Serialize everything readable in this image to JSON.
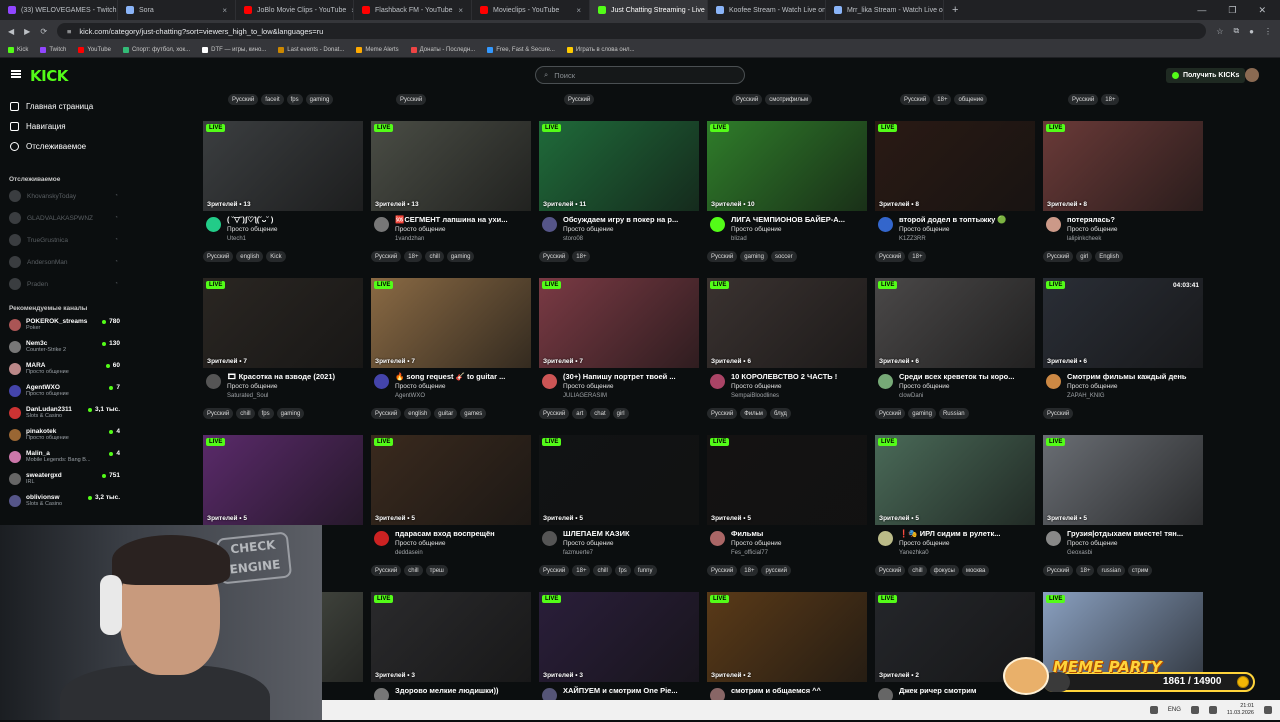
{
  "browser": {
    "tabs": [
      {
        "label": "(33) WELOVEGAMES - Twitch",
        "color": "#9146ff"
      },
      {
        "label": "Sora",
        "color": "#8ab4f8"
      },
      {
        "label": "JoBlo Movie Clips - YouTube",
        "color": "#ff0000"
      },
      {
        "label": "Flashback FM - YouTube",
        "color": "#ff0000"
      },
      {
        "label": "Movieclips - YouTube",
        "color": "#ff0000"
      },
      {
        "label": "Just Chatting Streaming - Live",
        "color": "#53fc18"
      },
      {
        "label": "Koofee Stream - Watch Live on",
        "color": "#8ab4f8"
      },
      {
        "label": "Mrr_lika Stream - Watch Live o",
        "color": "#8ab4f8"
      }
    ],
    "url": "kick.com/category/just-chatting?sort=viewers_high_to_low&languages=ru",
    "bookmarks": [
      "Kick",
      "Twitch",
      "YouTube",
      "Спорт: футбол, хок...",
      "DTF — игры, кино...",
      "Last events - Donat...",
      "Meme Alerts",
      "Донаты - Последн...",
      "Free, Fast & Secure...",
      "Играть в слова онл..."
    ]
  },
  "header": {
    "logo": "KICK",
    "search_placeholder": "Поиск",
    "get_kicks": "Получить KICKs"
  },
  "sidebar": {
    "nav": [
      "Главная страница",
      "Навигация",
      "Отслеживаемое"
    ],
    "followed_title": "Отслеживаемое",
    "followed": [
      "KhovanskyToday",
      "GLADVALAKASPWNZ",
      "TrueGrustnica",
      "AndersonMan",
      "Praden"
    ],
    "recommended_title": "Рекомендуемые каналы",
    "recommended": [
      {
        "name": "POKEROK_streams",
        "category": "Poker",
        "viewers": "780",
        "color": "#a55"
      },
      {
        "name": "Nem3c",
        "category": "Counter-Strike 2",
        "viewers": "130",
        "color": "#777"
      },
      {
        "name": "MARA",
        "category": "Просто общение",
        "viewers": "60",
        "color": "#b88"
      },
      {
        "name": "AgentWXO",
        "category": "Просто общение",
        "viewers": "7",
        "color": "#44a"
      },
      {
        "name": "DanLudan2311",
        "category": "Slots & Casino",
        "viewers": "3,1 тыс.",
        "color": "#c33"
      },
      {
        "name": "pinakotek",
        "category": "Просто общение",
        "viewers": "4",
        "color": "#963"
      },
      {
        "name": "Malin_a",
        "category": "Mobile Legends: Bang B...",
        "viewers": "4",
        "color": "#c7a"
      },
      {
        "name": "sweatergxd",
        "category": "IRL",
        "viewers": "751",
        "color": "#666"
      },
      {
        "name": "oblivionsw",
        "category": "Slots & Casino",
        "viewers": "3,2 тыс.",
        "color": "#558"
      }
    ]
  },
  "top_tags": [
    [
      "Русский",
      "faceit",
      "fps",
      "gaming"
    ],
    [
      "Русский"
    ],
    [
      "Русский"
    ],
    [
      "Русский",
      "смотрифильм"
    ],
    [
      "Русский",
      "18+",
      "общение"
    ],
    [
      "Русский",
      "18+"
    ]
  ],
  "cards": [
    {
      "title": "( ˘▽˘)ʃ♡ƪ(˘ᴗ˘ )",
      "category": "Просто общение",
      "channel": "Utech1",
      "viewers": "Зрителей • 13",
      "tags": [
        "Русский",
        "english",
        "Kick"
      ],
      "thumb": "#3b3e40",
      "avatar": "#2c8",
      "duration": ""
    },
    {
      "title": "🆘СЕГМЕНТ лапшина на ухи...",
      "category": "Просто общение",
      "channel": "1vandzhan",
      "viewers": "Зрителей • 13",
      "tags": [
        "Русский",
        "18+",
        "chill",
        "gaming"
      ],
      "thumb": "#4a4d45",
      "avatar": "#777",
      "duration": ""
    },
    {
      "title": "Обсуждаем игру в покер на р...",
      "category": "Просто общение",
      "channel": "storo08",
      "viewers": "Зрителей • 11",
      "tags": [
        "Русский",
        "18+"
      ],
      "thumb": "#1f6b3a",
      "avatar": "#558",
      "duration": ""
    },
    {
      "title": "ЛИГА ЧЕМПИОНОВ БАЙЕР-А...",
      "category": "Просто общение",
      "channel": "blizad",
      "viewers": "Зрителей • 10",
      "tags": [
        "Русский",
        "gaming",
        "soccer"
      ],
      "thumb": "#2f7d2a",
      "avatar": "#53fc18",
      "duration": ""
    },
    {
      "title": "второй додел в топтыжку 🟢",
      "category": "Просто общение",
      "channel": "K1ZZ3RR",
      "viewers": "Зрителей • 8",
      "tags": [
        "Русский",
        "18+"
      ],
      "thumb": "#2a1a14",
      "avatar": "#36c",
      "duration": ""
    },
    {
      "title": "потерялась?",
      "category": "Просто общение",
      "channel": "lalipinkcheek",
      "viewers": "Зрителей • 8",
      "tags": [
        "Русский",
        "girl",
        "English"
      ],
      "thumb": "#6a3a38",
      "avatar": "#c98",
      "duration": ""
    },
    {
      "title": "🎞 Красотка на взводе (2021)",
      "category": "Просто общение",
      "channel": "Saturated_Soul",
      "viewers": "Зрителей • 7",
      "tags": [
        "Русский",
        "chill",
        "fps",
        "gaming"
      ],
      "thumb": "#2a2622",
      "avatar": "#555",
      "duration": ""
    },
    {
      "title": "🔥 song request 🎸 to guitar ...",
      "category": "Просто общение",
      "channel": "AgentWXO",
      "viewers": "Зрителей • 7",
      "tags": [
        "Русский",
        "english",
        "guitar",
        "games"
      ],
      "thumb": "#8a6a44",
      "avatar": "#44a",
      "duration": ""
    },
    {
      "title": "(30+) Напишу портрет твоей ...",
      "category": "Просто общение",
      "channel": "JULIAGERASIM",
      "viewers": "Зрителей • 7",
      "tags": [
        "Русский",
        "art",
        "chat",
        "girl"
      ],
      "thumb": "#7a3a44",
      "avatar": "#c55",
      "duration": ""
    },
    {
      "title": "10 КОРОЛЕВСТВО 2 ЧАСТЬ !",
      "category": "Просто общение",
      "channel": "SempaiBloodlines",
      "viewers": "Зрителей • 6",
      "tags": [
        "Русский",
        "Фильм",
        "блуд"
      ],
      "thumb": "#3a3230",
      "avatar": "#a46",
      "duration": ""
    },
    {
      "title": "Среди всех креветок ты коро...",
      "category": "Просто общение",
      "channel": "clowDani",
      "viewers": "Зрителей • 6",
      "tags": [
        "Русский",
        "gaming",
        "Russian"
      ],
      "thumb": "#4a4848",
      "avatar": "#7a7",
      "duration": ""
    },
    {
      "title": "Смотрим фильмы каждый день",
      "category": "Просто общение",
      "channel": "ZAPAH_KNIG",
      "viewers": "Зрителей • 6",
      "tags": [
        "Русский"
      ],
      "thumb": "#2a2e36",
      "avatar": "#c84",
      "duration": "04:03:41"
    },
    {
      "title": "",
      "category": "",
      "channel": "",
      "viewers": "Зрителей • 5",
      "tags": [],
      "thumb": "#5a2a6a",
      "avatar": "#000",
      "duration": ""
    },
    {
      "title": "пдарасам вход воспрещён",
      "category": "Просто общение",
      "channel": "deddasein",
      "viewers": "Зрителей • 5",
      "tags": [
        "Русский",
        "chill",
        "треш"
      ],
      "thumb": "#3a2a1e",
      "avatar": "#c22",
      "duration": ""
    },
    {
      "title": "ШЛЕПАЕМ КАЗИК",
      "category": "Просто общение",
      "channel": "fazmuerte7",
      "viewers": "Зрителей • 5",
      "tags": [
        "Русский",
        "18+",
        "chill",
        "fps",
        "funny"
      ],
      "thumb": "#111314",
      "avatar": "#555",
      "duration": ""
    },
    {
      "title": "Фильмы",
      "category": "Просто общение",
      "channel": "Fes_official77",
      "viewers": "Зрителей • 5",
      "tags": [
        "Русский",
        "18+",
        "русский"
      ],
      "thumb": "#141212",
      "avatar": "#a66",
      "duration": ""
    },
    {
      "title": "❗🎭 ИРЛ сидим в рулетк...",
      "category": "Просто общение",
      "channel": "Yanezhka0",
      "viewers": "Зрителей • 5",
      "tags": [
        "Русский",
        "chill",
        "фокусы",
        "москва"
      ],
      "thumb": "#4a6a58",
      "avatar": "#bb8",
      "duration": ""
    },
    {
      "title": "Грузия|отдыхаем вместе! тян...",
      "category": "Просто общение",
      "channel": "Geoxasbi",
      "viewers": "Зрителей • 5",
      "tags": [
        "Русский",
        "18+",
        "russian",
        "стрим"
      ],
      "thumb": "#6a6e74",
      "avatar": "#888",
      "duration": ""
    },
    {
      "title": "...улич...",
      "category": "",
      "channel": "",
      "viewers": "",
      "tags": [],
      "thumb": "#555a50",
      "avatar": "#000",
      "duration": ""
    },
    {
      "title": "Здорово мелкие людишки))",
      "category": "",
      "channel": "",
      "viewers": "Зрителей • 3",
      "tags": [],
      "thumb": "#2a2a2c",
      "avatar": "#777",
      "duration": ""
    },
    {
      "title": "ХАЙПУЕМ и смотрим One Pie...",
      "category": "",
      "channel": "",
      "viewers": "Зрителей • 3",
      "tags": [],
      "thumb": "#2a1e3a",
      "avatar": "#557",
      "duration": ""
    },
    {
      "title": "смотрим и общаемся ^^",
      "category": "",
      "channel": "",
      "viewers": "Зрителей • 2",
      "tags": [],
      "thumb": "#5a3a18",
      "avatar": "#866",
      "duration": ""
    },
    {
      "title": "Джек ричер смотрим",
      "category": "",
      "channel": "",
      "viewers": "Зрителей • 2",
      "tags": [],
      "thumb": "#24262a",
      "avatar": "#666",
      "duration": ""
    },
    {
      "title": "",
      "category": "",
      "channel": "",
      "viewers": "",
      "tags": [],
      "thumb": "#8aa0c0",
      "avatar": "#000",
      "duration": ""
    }
  ],
  "live_label": "LIVE",
  "webcam": {
    "sign": "CHECK ENGINE"
  },
  "meme": {
    "title": "MEME PARTY",
    "count": "1861 / 14900",
    "progress": 0.125
  },
  "taskbar": {
    "lang": "ENG",
    "time": "21:01",
    "date": "11.03.2026"
  }
}
